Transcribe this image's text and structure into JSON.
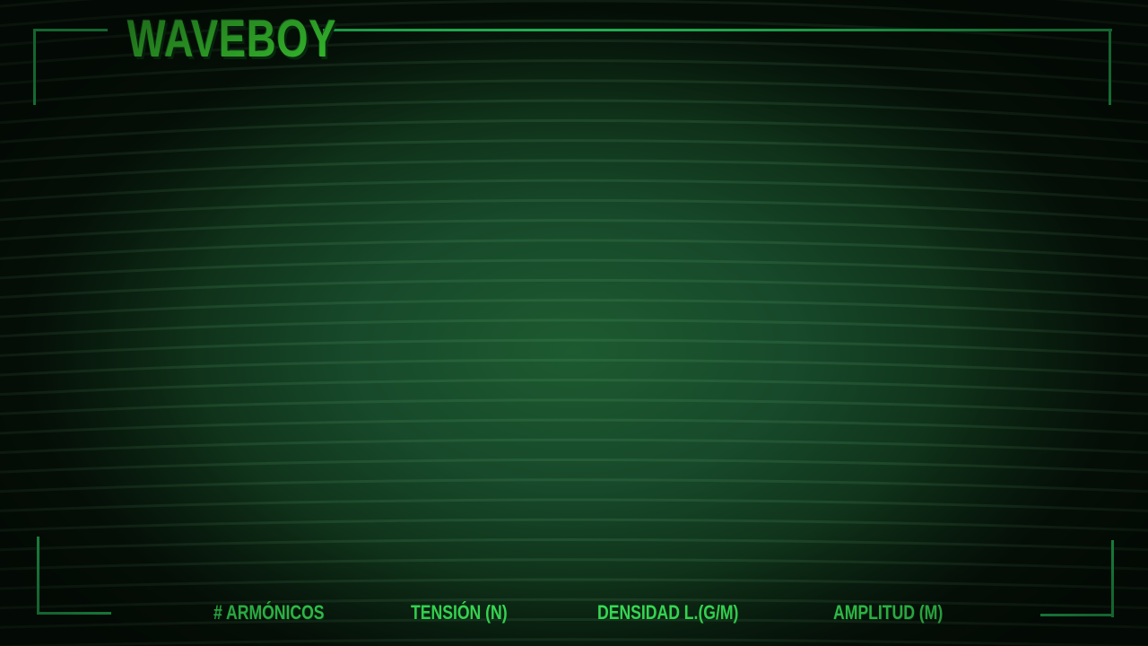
{
  "game": {
    "title": "WAVEBOY"
  },
  "controls": {
    "labels": [
      {
        "text": "# ARMÓNICOS"
      },
      {
        "text": "TENSIÓN (N)"
      },
      {
        "text": "DENSIDAD L.(G/M)"
      },
      {
        "text": "AMPLITUD (M)"
      }
    ]
  },
  "colors": {
    "accent": "#2be06a",
    "title": "#45f23a",
    "label": "#3ef35e",
    "background_center": "#1d5a30",
    "background_edge": "#061409"
  }
}
